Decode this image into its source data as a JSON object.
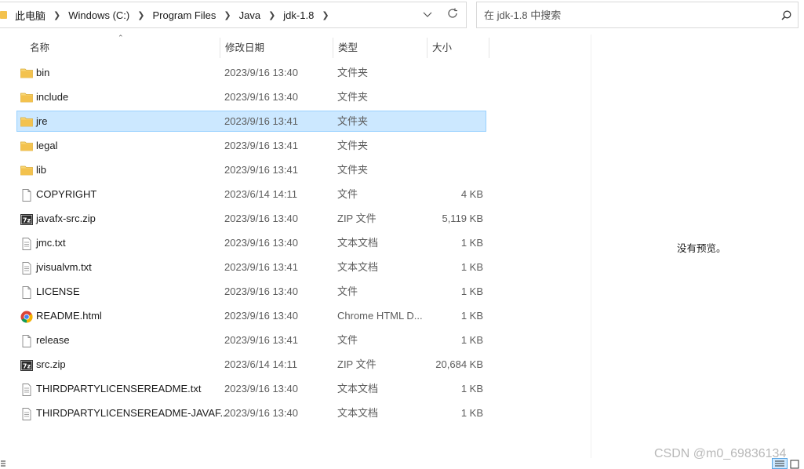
{
  "address": {
    "crumbs": [
      "此电脑",
      "Windows (C:)",
      "Program Files",
      "Java",
      "jdk-1.8"
    ]
  },
  "search": {
    "placeholder": "在 jdk-1.8 中搜索"
  },
  "columns": {
    "name": "名称",
    "date": "修改日期",
    "type": "类型",
    "size": "大小"
  },
  "files": [
    {
      "name": "bin",
      "date": "2023/9/16 13:40",
      "type": "文件夹",
      "size": "",
      "icon": "folder-icon"
    },
    {
      "name": "include",
      "date": "2023/9/16 13:40",
      "type": "文件夹",
      "size": "",
      "icon": "folder-icon"
    },
    {
      "name": "jre",
      "date": "2023/9/16 13:41",
      "type": "文件夹",
      "size": "",
      "icon": "folder-icon",
      "selected": true
    },
    {
      "name": "legal",
      "date": "2023/9/16 13:41",
      "type": "文件夹",
      "size": "",
      "icon": "folder-icon"
    },
    {
      "name": "lib",
      "date": "2023/9/16 13:41",
      "type": "文件夹",
      "size": "",
      "icon": "folder-icon"
    },
    {
      "name": "COPYRIGHT",
      "date": "2023/6/14 14:11",
      "type": "文件",
      "size": "4 KB",
      "icon": "file-icon"
    },
    {
      "name": "javafx-src.zip",
      "date": "2023/9/16 13:40",
      "type": "ZIP 文件",
      "size": "5,119 KB",
      "icon": "zip-icon"
    },
    {
      "name": "jmc.txt",
      "date": "2023/9/16 13:40",
      "type": "文本文档",
      "size": "1 KB",
      "icon": "text-file-icon"
    },
    {
      "name": "jvisualvm.txt",
      "date": "2023/9/16 13:41",
      "type": "文本文档",
      "size": "1 KB",
      "icon": "text-file-icon"
    },
    {
      "name": "LICENSE",
      "date": "2023/9/16 13:40",
      "type": "文件",
      "size": "1 KB",
      "icon": "file-icon"
    },
    {
      "name": "README.html",
      "date": "2023/9/16 13:40",
      "type": "Chrome HTML D...",
      "size": "1 KB",
      "icon": "chrome-icon"
    },
    {
      "name": "release",
      "date": "2023/9/16 13:41",
      "type": "文件",
      "size": "1 KB",
      "icon": "file-icon"
    },
    {
      "name": "src.zip",
      "date": "2023/6/14 14:11",
      "type": "ZIP 文件",
      "size": "20,684 KB",
      "icon": "zip-icon"
    },
    {
      "name": "THIRDPARTYLICENSEREADME.txt",
      "date": "2023/9/16 13:40",
      "type": "文本文档",
      "size": "1 KB",
      "icon": "text-file-icon"
    },
    {
      "name": "THIRDPARTYLICENSEREADME-JAVAF...",
      "date": "2023/9/16 13:40",
      "type": "文本文档",
      "size": "1 KB",
      "icon": "text-file-icon"
    }
  ],
  "preview": {
    "empty_text": "没有预览。"
  },
  "watermark": "CSDN @m0_69836134",
  "colors": {
    "selection": "#cce8ff",
    "selection_border": "#99d1ff",
    "folder": "#f3c24e"
  }
}
